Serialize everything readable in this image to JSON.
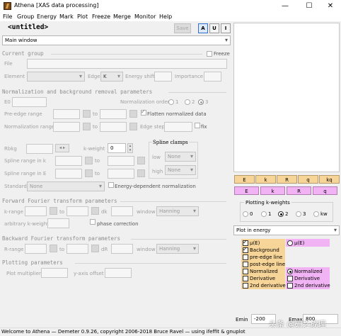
{
  "window": {
    "title": "Athena [XAS data processing]",
    "controls": [
      "—",
      "☐",
      "✕"
    ]
  },
  "menu": [
    "File",
    "Group",
    "Energy",
    "Mark",
    "Plot",
    "Freeze",
    "Merge",
    "Monitor",
    "Help"
  ],
  "toolbar": {
    "project_name": "<untitled>",
    "save_label": "Save",
    "modes": [
      "A",
      "U",
      "I"
    ],
    "active_mode": "A"
  },
  "view_select": "Main window",
  "current_group": {
    "header": "Current group",
    "freeze_label": "Freeze",
    "file_label": "File",
    "element_label": "Element",
    "edge_label": "Edge",
    "edge_value": "K",
    "eshift_label": "Energy shift",
    "importance_label": "Importance"
  },
  "normalization": {
    "header": "Normalization and background removal parameters",
    "e0_label": "E0",
    "order_label": "Normalization order",
    "orders": [
      "1",
      "2",
      "3"
    ],
    "order_selected": "3",
    "pre_edge_label": "Pre-edge range",
    "to_label": "to",
    "flatten_label": "Flatten normalized data",
    "flatten_checked": true,
    "norm_range_label": "Normalization range",
    "edge_step_label": "Edge step",
    "fix_label": "fix",
    "rbkg_label": "Rbkg",
    "kweight_label": "k-weight",
    "kweight_value": "0",
    "spline_clamps_label": "Spline clamps",
    "spline_k_label": "Spline range in k",
    "spline_e_label": "Spline range in E",
    "low_label": "low",
    "low_value": "None",
    "high_label": "high",
    "high_value": "None",
    "standard_label": "Standard",
    "standard_value": "None",
    "energy_dep_label": "Energy-dependent normalization"
  },
  "forward_ft": {
    "header": "Forward Fourier transform parameters",
    "krange_label": "k-range",
    "to_label": "to",
    "dk_label": "dk",
    "window_label": "window",
    "window_value": "Hanning",
    "arb_kw_label": "arbitrary k-weight",
    "phase_label": "phase correction"
  },
  "backward_ft": {
    "header": "Backward Fourier transform parameters",
    "rrange_label": "R-range",
    "to_label": "to",
    "dr_label": "dR",
    "window_label": "window",
    "window_value": "Hanning"
  },
  "plotting": {
    "header": "Plotting parameters",
    "multiplier_label": "Plot multiplier",
    "offset_label": "y-axis offset"
  },
  "plot_buttons": {
    "row1": [
      "E",
      "k",
      "R",
      "q",
      "kq"
    ],
    "row2": [
      "E",
      "k",
      "R",
      "q"
    ]
  },
  "kweights": {
    "title": "Plotting k-weights",
    "options": [
      "0",
      "1",
      "2",
      "3",
      "kw"
    ],
    "selected": "2"
  },
  "plot_in": "Plot in energy",
  "plot_options": {
    "left": [
      {
        "label": "μ(E)",
        "checked": true
      },
      {
        "label": "Background",
        "checked": true
      },
      {
        "label": "pre-edge line",
        "checked": false
      },
      {
        "label": "post-edge line",
        "checked": false
      },
      {
        "label": "Normalized",
        "checked": false
      },
      {
        "label": "Derivative",
        "checked": false
      },
      {
        "label": "2nd derivative",
        "checked": false
      }
    ],
    "right_top": "μ(E)",
    "right": [
      {
        "label": "Normalized",
        "selected": true
      },
      {
        "label": "Derivative",
        "checked": false
      },
      {
        "label": "2nd derivative",
        "checked": false
      }
    ]
  },
  "emin_label": "Emin",
  "emin_value": "-200",
  "emax_label": "Emax",
  "emax_value": "800",
  "status": "Welcome to Athena — Demeter 0.9.26, copyright 2006-2018 Bruce Ravel — using ifeffit & gnuplot",
  "watermark": "头条 @研之成理",
  "colors": {
    "energy_btn": "#f7d497",
    "r_btn": "#f2b3f5",
    "active_mode_border": "#2f6fd0"
  }
}
